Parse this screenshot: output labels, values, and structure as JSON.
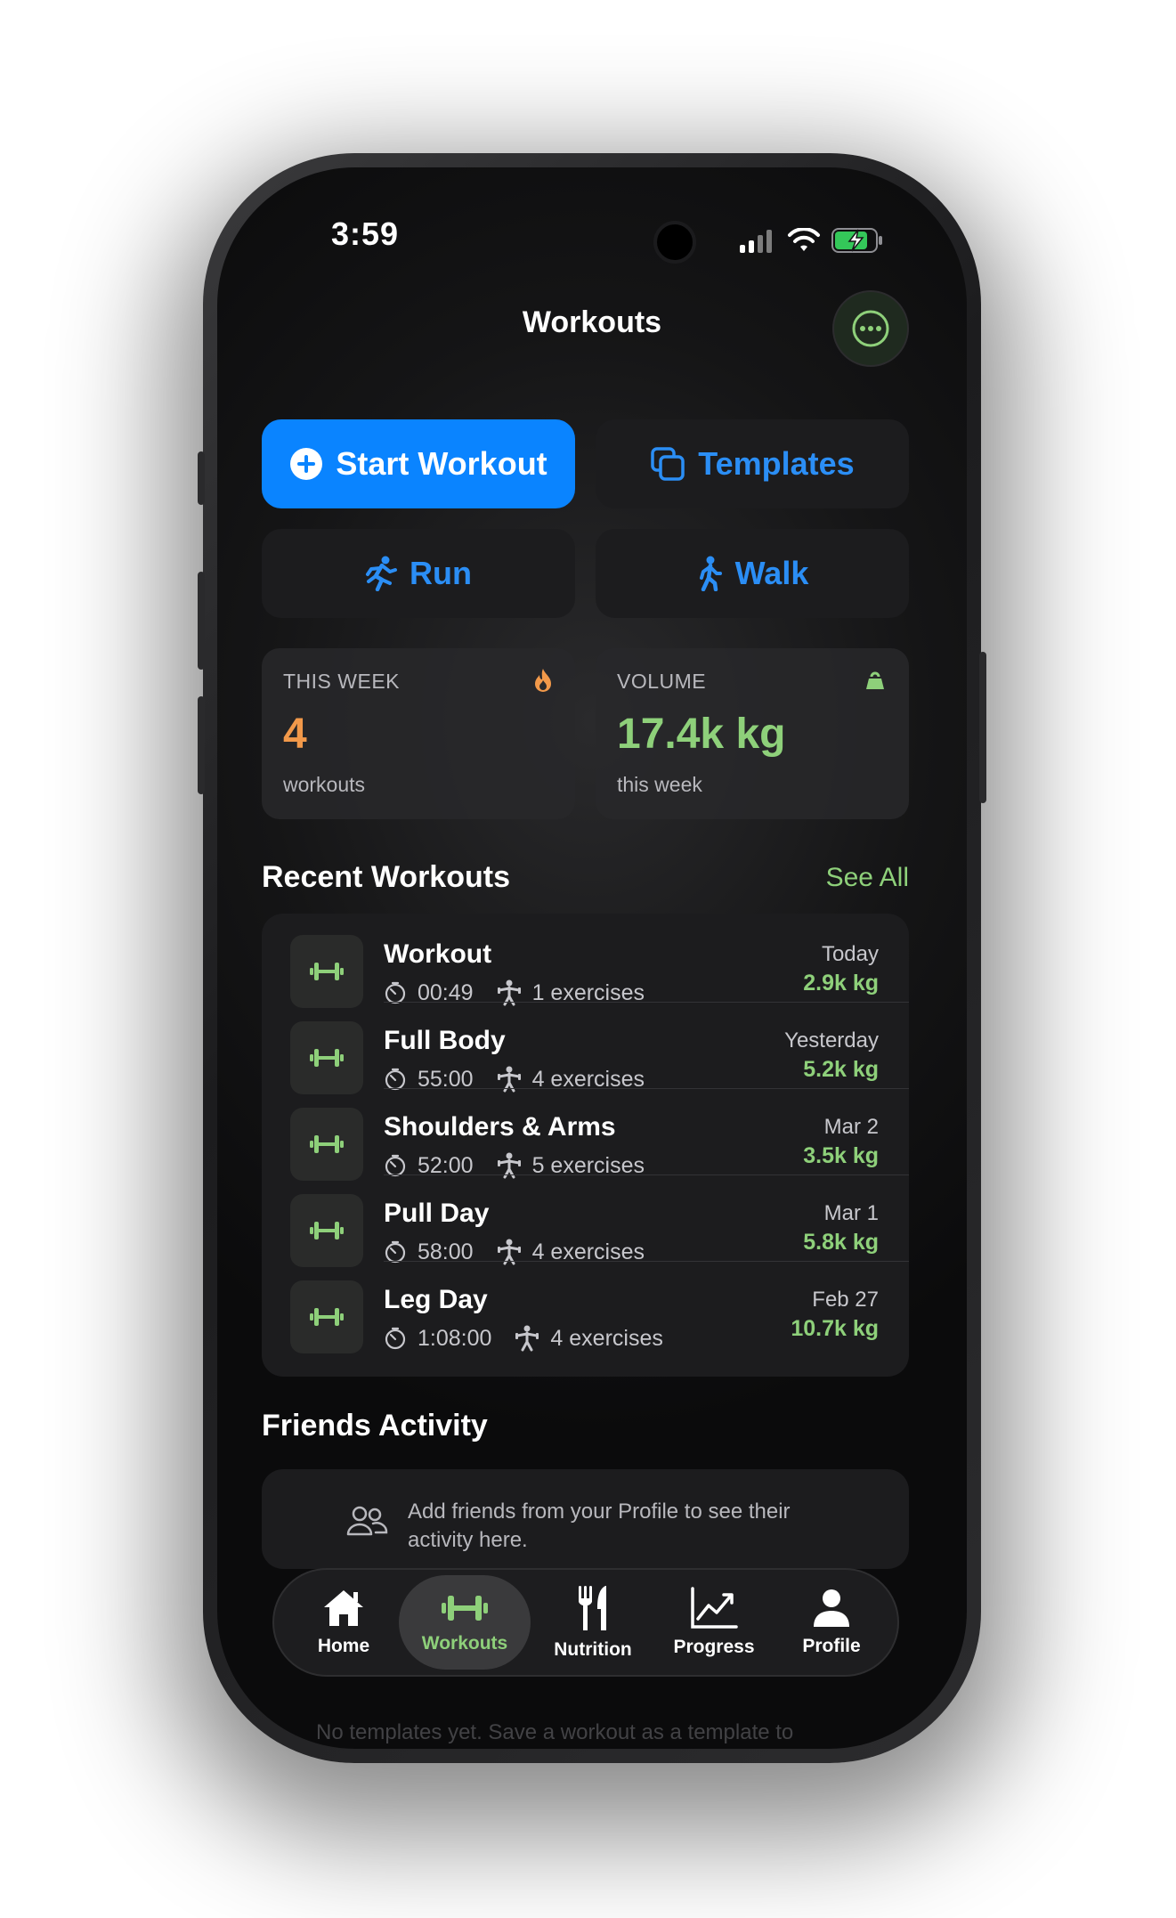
{
  "status_bar": {
    "time": "3:59"
  },
  "header": {
    "title": "Workouts",
    "more_icon": "ellipsis-circle-icon"
  },
  "actions": {
    "start_workout": "Start Workout",
    "templates": "Templates",
    "run": "Run",
    "walk": "Walk"
  },
  "stats": {
    "this_week": {
      "label": "THIS WEEK",
      "value": "4",
      "sub": "workouts",
      "icon": "flame-icon",
      "color": "#f2994a"
    },
    "volume": {
      "label": "VOLUME",
      "value": "17.4k kg",
      "sub": "this week",
      "icon": "kettlebell-icon",
      "color": "#8ed07a"
    }
  },
  "recent": {
    "title": "Recent Workouts",
    "see_all": "See All",
    "items": [
      {
        "name": "Workout",
        "duration": "00:49",
        "exercises": "1 exercises",
        "date": "Today",
        "volume": "2.9k kg"
      },
      {
        "name": "Full Body",
        "duration": "55:00",
        "exercises": "4 exercises",
        "date": "Yesterday",
        "volume": "5.2k kg"
      },
      {
        "name": "Shoulders & Arms",
        "duration": "52:00",
        "exercises": "5 exercises",
        "date": "Mar 2",
        "volume": "3.5k kg"
      },
      {
        "name": "Pull Day",
        "duration": "58:00",
        "exercises": "4 exercises",
        "date": "Mar 1",
        "volume": "5.8k kg"
      },
      {
        "name": "Leg Day",
        "duration": "1:08:00",
        "exercises": "4 exercises",
        "date": "Feb 27",
        "volume": "10.7k kg"
      }
    ]
  },
  "friends": {
    "title": "Friends Activity",
    "empty_text": "Add friends from your Profile to see their activity here."
  },
  "templates_section": {
    "empty_text": "No templates yet. Save a workout as a template to"
  },
  "tabbar": {
    "home": "Home",
    "workouts": "Workouts",
    "nutrition": "Nutrition",
    "progress": "Progress",
    "profile": "Profile",
    "active": "Workouts"
  },
  "colors": {
    "accent_blue": "#0a84ff",
    "accent_green": "#8ed07a",
    "accent_orange": "#f2994a"
  }
}
